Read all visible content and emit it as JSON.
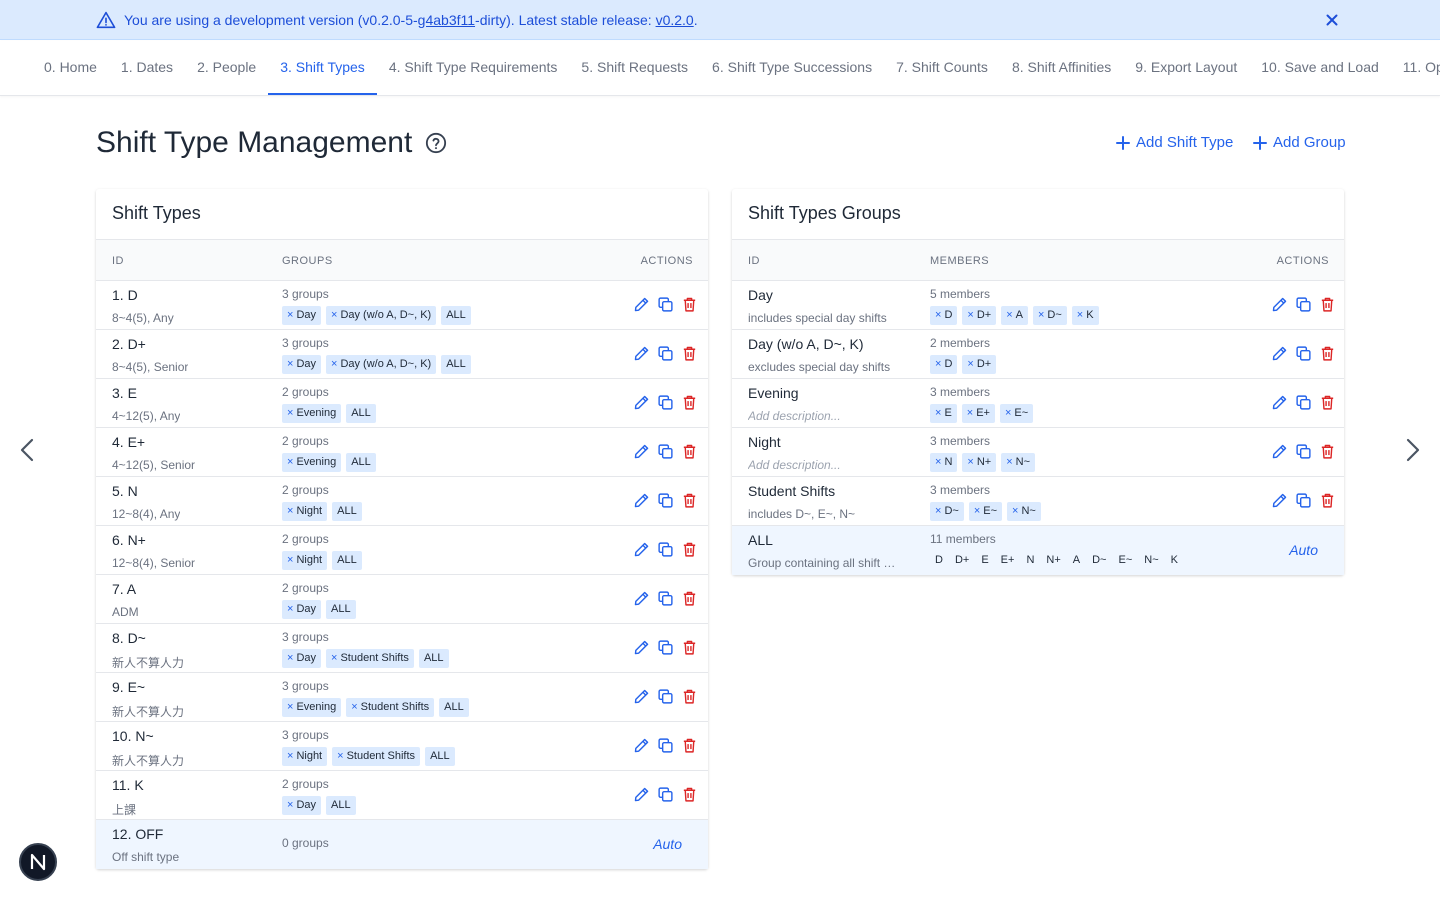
{
  "banner": {
    "prefix": "You are using a development version (v0.2.0-5-",
    "commit": "g4ab3f11",
    "middle": "-dirty). Latest stable release: ",
    "stable": "v0.2.0",
    "suffix": "."
  },
  "tabs": [
    "0. Home",
    "1. Dates",
    "2. People",
    "3. Shift Types",
    "4. Shift Type Requirements",
    "5. Shift Requests",
    "6. Shift Type Successions",
    "7. Shift Counts",
    "8. Shift Affinities",
    "9. Export Layout",
    "10. Save and Load",
    "11. Op"
  ],
  "active_tab": "3. Shift Types",
  "page": {
    "title": "Shift Type Management",
    "add_shift_type": "Add Shift Type",
    "add_group": "Add Group"
  },
  "shift_types": {
    "title": "Shift Types",
    "headers": {
      "id": "ID",
      "groups": "GROUPS",
      "actions": "ACTIONS"
    },
    "rows": [
      {
        "name": "1. D",
        "desc": "8~4(5), Any",
        "count": "3 groups",
        "chips": [
          {
            "label": "Day",
            "x": true
          },
          {
            "label": "Day (w/o A, D~, K)",
            "x": true
          },
          {
            "label": "ALL",
            "x": false
          }
        ]
      },
      {
        "name": "2. D+",
        "desc": "8~4(5), Senior",
        "count": "3 groups",
        "chips": [
          {
            "label": "Day",
            "x": true
          },
          {
            "label": "Day (w/o A, D~, K)",
            "x": true
          },
          {
            "label": "ALL",
            "x": false
          }
        ]
      },
      {
        "name": "3. E",
        "desc": "4~12(5), Any",
        "count": "2 groups",
        "chips": [
          {
            "label": "Evening",
            "x": true
          },
          {
            "label": "ALL",
            "x": false
          }
        ]
      },
      {
        "name": "4. E+",
        "desc": "4~12(5), Senior",
        "count": "2 groups",
        "chips": [
          {
            "label": "Evening",
            "x": true
          },
          {
            "label": "ALL",
            "x": false
          }
        ]
      },
      {
        "name": "5. N",
        "desc": "12~8(4), Any",
        "count": "2 groups",
        "chips": [
          {
            "label": "Night",
            "x": true
          },
          {
            "label": "ALL",
            "x": false
          }
        ]
      },
      {
        "name": "6. N+",
        "desc": "12~8(4), Senior",
        "count": "2 groups",
        "chips": [
          {
            "label": "Night",
            "x": true
          },
          {
            "label": "ALL",
            "x": false
          }
        ]
      },
      {
        "name": "7. A",
        "desc": "ADM",
        "count": "2 groups",
        "chips": [
          {
            "label": "Day",
            "x": true
          },
          {
            "label": "ALL",
            "x": false
          }
        ]
      },
      {
        "name": "8. D~",
        "desc": "新人不算人力",
        "count": "3 groups",
        "chips": [
          {
            "label": "Day",
            "x": true
          },
          {
            "label": "Student Shifts",
            "x": true
          },
          {
            "label": "ALL",
            "x": false
          }
        ]
      },
      {
        "name": "9. E~",
        "desc": "新人不算人力",
        "count": "3 groups",
        "chips": [
          {
            "label": "Evening",
            "x": true
          },
          {
            "label": "Student Shifts",
            "x": true
          },
          {
            "label": "ALL",
            "x": false
          }
        ]
      },
      {
        "name": "10. N~",
        "desc": "新人不算人力",
        "count": "3 groups",
        "chips": [
          {
            "label": "Night",
            "x": true
          },
          {
            "label": "Student Shifts",
            "x": true
          },
          {
            "label": "ALL",
            "x": false
          }
        ]
      },
      {
        "name": "11. K",
        "desc": "上課",
        "count": "2 groups",
        "chips": [
          {
            "label": "Day",
            "x": true
          },
          {
            "label": "ALL",
            "x": false
          }
        ]
      }
    ],
    "auto_row": {
      "name": "12. OFF",
      "desc": "Off shift type",
      "count": "0 groups",
      "auto": "Auto"
    }
  },
  "groups": {
    "title": "Shift Types Groups",
    "headers": {
      "id": "ID",
      "members": "MEMBERS",
      "actions": "ACTIONS"
    },
    "rows": [
      {
        "name": "Day",
        "desc": "includes special day shifts",
        "placeholder": false,
        "count": "5 members",
        "chips": [
          "D",
          "D+",
          "A",
          "D~",
          "K"
        ]
      },
      {
        "name": "Day (w/o A, D~, K)",
        "desc": "excludes special day shifts",
        "placeholder": false,
        "count": "2 members",
        "chips": [
          "D",
          "D+"
        ]
      },
      {
        "name": "Evening",
        "desc": "Add description...",
        "placeholder": true,
        "count": "3 members",
        "chips": [
          "E",
          "E+",
          "E~"
        ]
      },
      {
        "name": "Night",
        "desc": "Add description...",
        "placeholder": true,
        "count": "3 members",
        "chips": [
          "N",
          "N+",
          "N~"
        ]
      },
      {
        "name": "Student Shifts",
        "desc": "includes D~, E~, N~",
        "placeholder": false,
        "count": "3 members",
        "chips": [
          "D~",
          "E~",
          "N~"
        ]
      }
    ],
    "auto_row": {
      "name": "ALL",
      "desc": "Group containing all shift types",
      "count": "11 members",
      "chips": [
        "D",
        "D+",
        "E",
        "E+",
        "N",
        "N+",
        "A",
        "D~",
        "E~",
        "N~",
        "K"
      ],
      "auto": "Auto"
    }
  },
  "colors": {
    "accent": "#2563eb",
    "danger": "#dc2626",
    "banner_bg": "#dbeafe",
    "chip_bg": "#dbeafe"
  },
  "icons": [
    "warning-icon",
    "close-icon",
    "help-icon",
    "plus-icon",
    "edit-icon",
    "duplicate-icon",
    "delete-icon",
    "chevron-left-icon",
    "chevron-right-icon",
    "logo-icon"
  ]
}
